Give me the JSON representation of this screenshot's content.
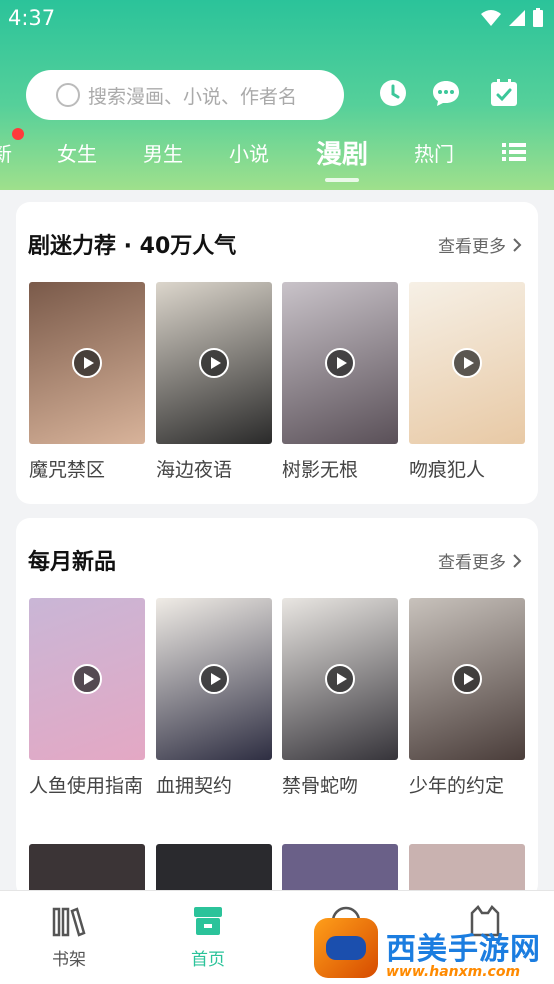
{
  "status": {
    "time": "4:37"
  },
  "search": {
    "placeholder": "搜索漫画、小说、作者名"
  },
  "tabs": [
    {
      "label": "新"
    },
    {
      "label": "女生"
    },
    {
      "label": "男生"
    },
    {
      "label": "小说"
    },
    {
      "label": "漫剧",
      "active": true
    },
    {
      "label": "热门"
    }
  ],
  "sections": [
    {
      "title": "剧迷力荐 · 40万人气",
      "more": "查看更多",
      "items": [
        {
          "name": "魔咒禁区",
          "colors": [
            "#7a5a4a",
            "#d8b39a"
          ]
        },
        {
          "name": "海边夜语",
          "colors": [
            "#dcd6cc",
            "#2a2a2a"
          ]
        },
        {
          "name": "树影无根",
          "colors": [
            "#c9c3c9",
            "#5a5058"
          ]
        },
        {
          "name": "吻痕犯人",
          "colors": [
            "#f6f0e6",
            "#e8c9a5"
          ]
        }
      ]
    },
    {
      "title": "每月新品",
      "more": "查看更多",
      "items": [
        {
          "name": "人鱼使用指南",
          "colors": [
            "#c9b6d6",
            "#e4a8c4"
          ]
        },
        {
          "name": "血拥契约",
          "colors": [
            "#f0ece6",
            "#2e2e42"
          ]
        },
        {
          "name": "禁骨蛇吻",
          "colors": [
            "#e9e6e2",
            "#36343a"
          ]
        },
        {
          "name": "少年的约定",
          "colors": [
            "#c8c2bc",
            "#4a3d3a"
          ]
        }
      ]
    }
  ],
  "nav": [
    {
      "label": "书架",
      "icon": "bookshelf-icon"
    },
    {
      "label": "首页",
      "icon": "home-store-icon",
      "active": true
    },
    {
      "label": "",
      "icon": "community-icon"
    },
    {
      "label": "",
      "icon": "profile-icon"
    }
  ],
  "watermark": {
    "text": "西美手游网",
    "url": "www.hanxm.com"
  },
  "colors": {
    "accent": "#2bc39a",
    "badge": "#ff3b3b"
  }
}
